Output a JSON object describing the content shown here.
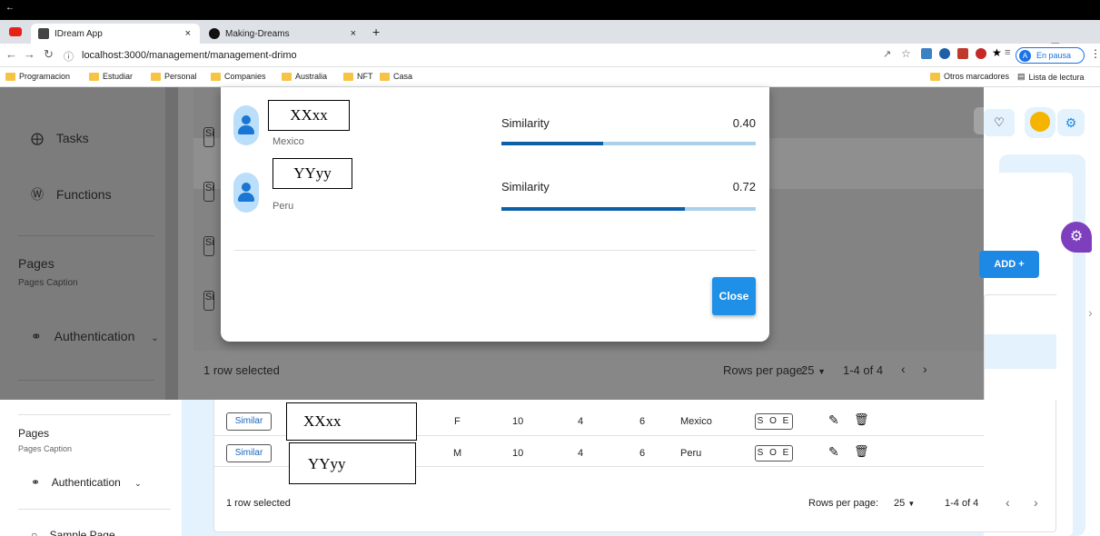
{
  "browser": {
    "tabs": [
      {
        "title": "IDream App",
        "close": "×"
      },
      {
        "title": "Making-Dreams",
        "close": "×"
      }
    ],
    "new_tab": "+",
    "url": "localhost:3000/management/management-drimo",
    "profile_status": "En pausa",
    "profile_initial": "A",
    "bookmarks": [
      "Programacion",
      "Estudiar",
      "Personal",
      "Companies",
      "Australia",
      "NFT",
      "Casa"
    ],
    "other_bookmarks": "Otros marcadores",
    "reading_list": "Lista de lectura"
  },
  "sidebar_dim": {
    "items": [
      "Tasks",
      "Functions"
    ],
    "section_title": "Pages",
    "section_caption": "Pages Caption",
    "auth_label": "Authentication"
  },
  "sidebar_lower": {
    "section_title": "Pages",
    "section_caption": "Pages Caption",
    "auth_label": "Authentication",
    "next_item": "Sample Page"
  },
  "toolbar": {
    "add_label": "ADD  +"
  },
  "modal": {
    "users": [
      {
        "name": "XXxx",
        "country": "Mexico",
        "similarity_label": "Similarity",
        "similarity": "0.40",
        "fraction": 0.4
      },
      {
        "name": "YYyy",
        "country": "Peru",
        "similarity_label": "Similarity",
        "similarity": "0.72",
        "fraction": 0.72
      }
    ],
    "close_label": "Close"
  },
  "dim_footer": {
    "selected": "1 row selected",
    "rows_per_page_label": "Rows per page:",
    "rows_per_page": "25",
    "range": "1-4 of 4"
  },
  "table": {
    "rows": [
      {
        "action": "Similar",
        "name": "XXxx",
        "gender": "F",
        "c1": "10",
        "c2": "4",
        "c3": "6",
        "country": "Mexico",
        "tag": "S O E"
      },
      {
        "action": "Similar",
        "name": "YYyy",
        "gender": "M",
        "c1": "10",
        "c2": "4",
        "c3": "6",
        "country": "Peru",
        "tag": "S O E"
      }
    ],
    "selected": "1 row selected",
    "rows_per_page_label": "Rows per page:",
    "rows_per_page": "25",
    "range": "1-4 of 4"
  },
  "colors": {
    "accent": "#1e88e5",
    "bar_fill": "#0d5fa8",
    "bar_track": "#a9d2ea",
    "fab": "#7e3fbf"
  }
}
